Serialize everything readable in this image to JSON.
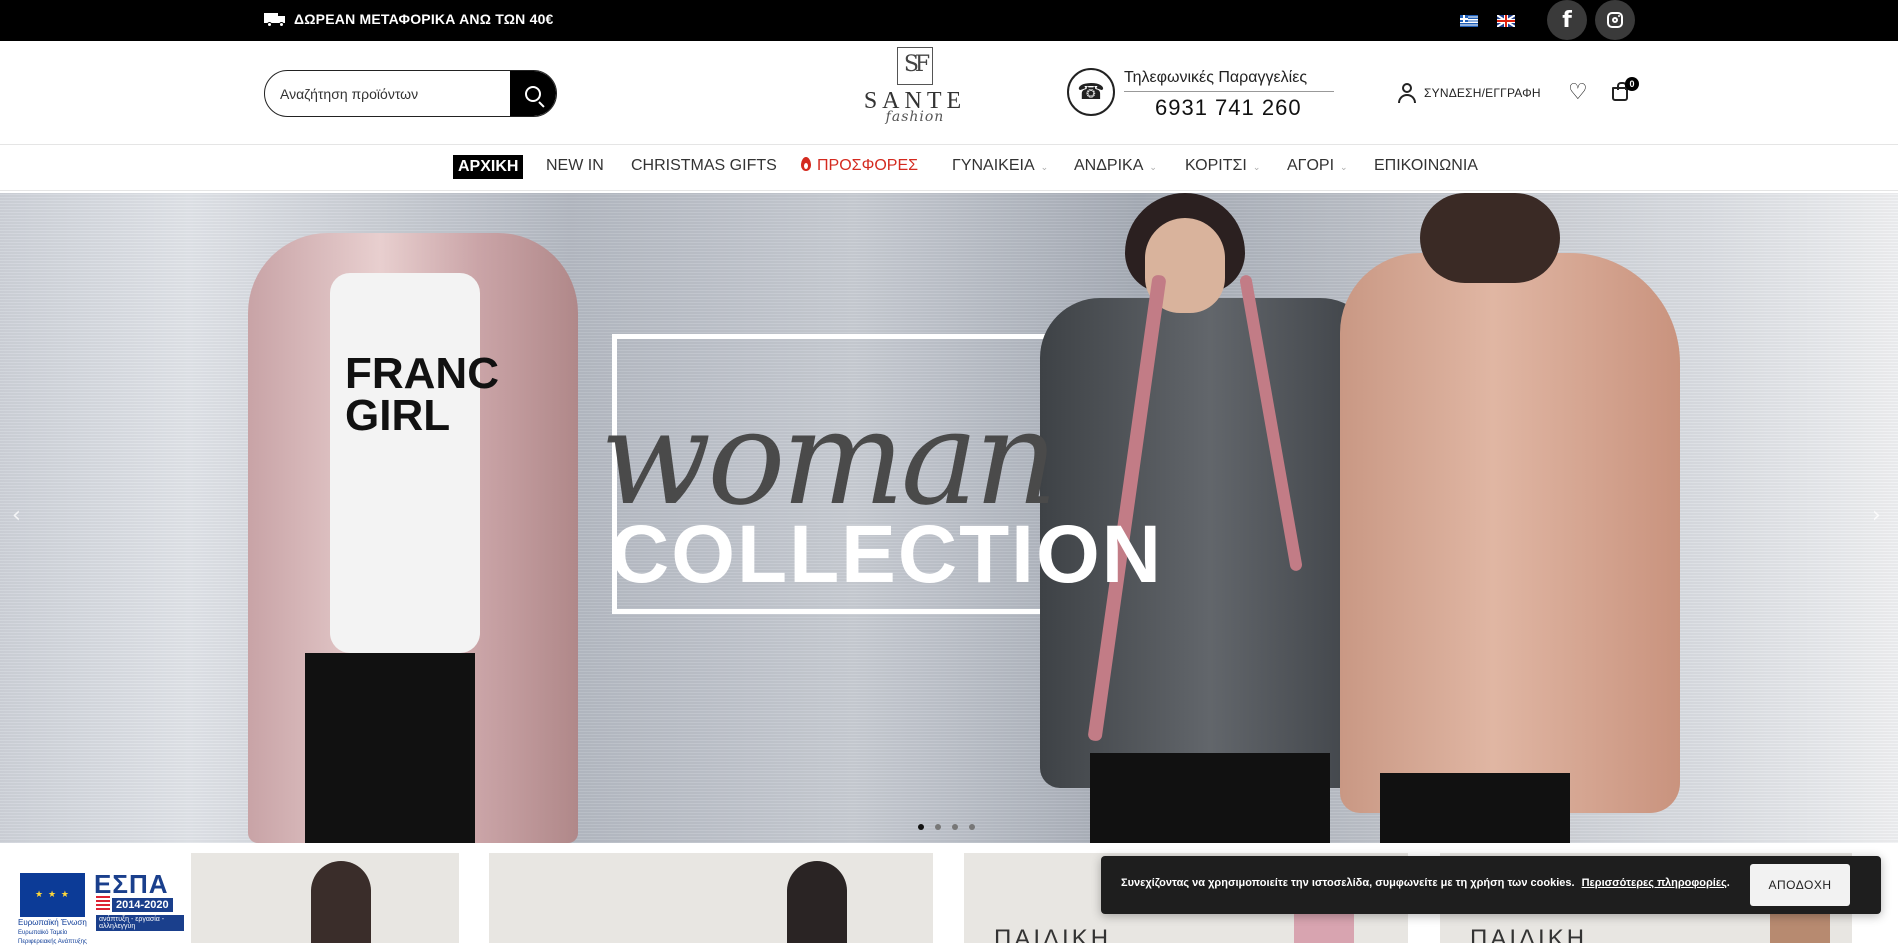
{
  "topbar": {
    "shipping_text": "ΔΩΡΕΑΝ ΜΕΤΑΦΟΡΙΚΑ ΑΝΩ ΤΩΝ 40€",
    "languages": [
      "greek-flag",
      "uk-flag"
    ],
    "social": [
      "facebook-icon",
      "instagram-icon"
    ],
    "facebook_glyph": "f"
  },
  "header": {
    "search_placeholder": "Αναζήτηση προϊόντων",
    "logo_name": "SANTE",
    "logo_sub": "fashion",
    "phone_label": "Τηλεφωνικές Παραγγελίες",
    "phone_number": "6931 741 260",
    "phone_glyph": "☎",
    "account_label": "ΣΥΝΔΕΣΗ/ΕΓΓΡΑΦΗ",
    "wishlist_glyph": "♡",
    "cart_count": "0"
  },
  "nav": {
    "items": [
      {
        "label": "ΑΡΧΙΚΗ"
      },
      {
        "label": "NEW IN"
      },
      {
        "label": "CHRISTMAS GIFTS"
      },
      {
        "label": "ΠΡΟΣΦΟΡΕΣ"
      },
      {
        "label": "ΓΥΝΑΙΚΕΙΑ"
      },
      {
        "label": "ΑΝΔΡΙΚΑ"
      },
      {
        "label": "ΚΟΡΙΤΣΙ"
      },
      {
        "label": "ΑΓΟΡΙ"
      },
      {
        "label": "ΕΠΙΚΟΙΝΩΝΙΑ"
      }
    ],
    "caret": "⌄"
  },
  "hero": {
    "script_text": "woman",
    "title": "COLLECTION",
    "model_shirt_text": "FRANC\nGIRL",
    "arrow_left": "‹",
    "arrow_right": "›",
    "slides": 4,
    "active_slide": 1
  },
  "strip": {
    "card_labels": [
      "ΠΑΙΔΙΚΗ",
      "ΠΑΙΔΙΚΗ"
    ],
    "espa": {
      "title": "ΕΣΠΑ",
      "years": "2014-2020",
      "sub": "ανάπτυξη - εργασία - αλληλεγγύη",
      "eu_text": "Ευρωπαϊκή Ένωση",
      "eu_subtext": "Ευρωπαϊκό Ταμείο Περιφερειακής Ανάπτυξης",
      "eu_stars": "★ ★ ★"
    }
  },
  "cookie": {
    "text": "Συνεχίζοντας να χρησιμοποιείτε την ιστοσελίδα, συμφωνείτε με τη χρήση των cookies.",
    "link": "Περισσότερες πληροφορίες",
    "accept": "ΑΠΟΔΟΧΗ"
  },
  "colors": {
    "topbar_bg": "#000000",
    "sale_red": "#d42a1f",
    "cookie_bg": "#1e1e1e"
  }
}
